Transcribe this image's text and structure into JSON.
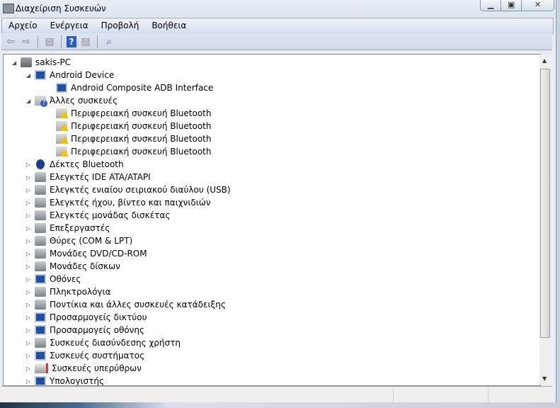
{
  "window": {
    "title": "Διαχείριση Συσκευών",
    "controls": [
      "minimize",
      "maximize",
      "close"
    ]
  },
  "menu": [
    "Αρχείο",
    "Ενέργεια",
    "Προβολή",
    "Βοήθεια"
  ],
  "toolbar": [
    "back-icon",
    "forward-icon",
    "show-hide-console-tree-icon",
    "help-icon",
    "show-action-pane-icon",
    "scan-hardware-icon"
  ],
  "tree": [
    {
      "level": 0,
      "label": "sakis-PC",
      "icon": "pc",
      "expanded": true
    },
    {
      "level": 1,
      "label": "Android Device",
      "icon": "mon",
      "expanded": true
    },
    {
      "level": 2,
      "label": "Android Composite ADB Interface",
      "icon": "mon"
    },
    {
      "level": 1,
      "label": "Άλλες συσκευές",
      "icon": "q",
      "expanded": true
    },
    {
      "level": 2,
      "label": "Περιφερειακή συσκευή Bluetooth",
      "icon": "warn"
    },
    {
      "level": 2,
      "label": "Περιφερειακή συσκευή Bluetooth",
      "icon": "warn"
    },
    {
      "level": 2,
      "label": "Περιφερειακή συσκευή Bluetooth",
      "icon": "warn"
    },
    {
      "level": 2,
      "label": "Περιφερειακή συσκευή Bluetooth",
      "icon": "warn"
    },
    {
      "level": 1,
      "label": "Δέκτες Bluetooth",
      "icon": "bt",
      "expanded": false
    },
    {
      "level": 1,
      "label": "Ελεγκτές IDE ATA/ATAPI",
      "icon": "gen",
      "expanded": false
    },
    {
      "level": 1,
      "label": "Ελεγκτές ενιαίου σειριακού διαύλου (USB)",
      "icon": "gen",
      "expanded": false
    },
    {
      "level": 1,
      "label": "Ελεγκτές ήχου, βίντεο και παιχνιδιών",
      "icon": "gen",
      "expanded": false
    },
    {
      "level": 1,
      "label": "Ελεγκτές μονάδας δισκέτας",
      "icon": "gen",
      "expanded": false
    },
    {
      "level": 1,
      "label": "Επεξεργαστές",
      "icon": "gen",
      "expanded": false
    },
    {
      "level": 1,
      "label": "Θύρες (COM & LPT)",
      "icon": "gen",
      "expanded": false
    },
    {
      "level": 1,
      "label": "Μονάδες DVD/CD-ROM",
      "icon": "gen",
      "expanded": false
    },
    {
      "level": 1,
      "label": "Μονάδες δίσκων",
      "icon": "gen",
      "expanded": false
    },
    {
      "level": 1,
      "label": "Οθόνες",
      "icon": "mon",
      "expanded": false
    },
    {
      "level": 1,
      "label": "Πληκτρολόγια",
      "icon": "gen",
      "expanded": false
    },
    {
      "level": 1,
      "label": "Ποντίκια και άλλες συσκευές κατάδειξης",
      "icon": "gen",
      "expanded": false
    },
    {
      "level": 1,
      "label": "Προσαρμογείς δικτύου",
      "icon": "mon",
      "expanded": false
    },
    {
      "level": 1,
      "label": "Προσαρμογείς οθόνης",
      "icon": "mon",
      "expanded": false
    },
    {
      "level": 1,
      "label": "Συσκευές διασύνδεσης χρήστη",
      "icon": "gen",
      "expanded": false
    },
    {
      "level": 1,
      "label": "Συσκευές συστήματος",
      "icon": "mon",
      "expanded": false
    },
    {
      "level": 1,
      "label": "Συσκευές υπερύθρων",
      "icon": "ir",
      "expanded": false
    },
    {
      "level": 1,
      "label": "Υπολογιστής",
      "icon": "mon",
      "expanded": false
    }
  ]
}
